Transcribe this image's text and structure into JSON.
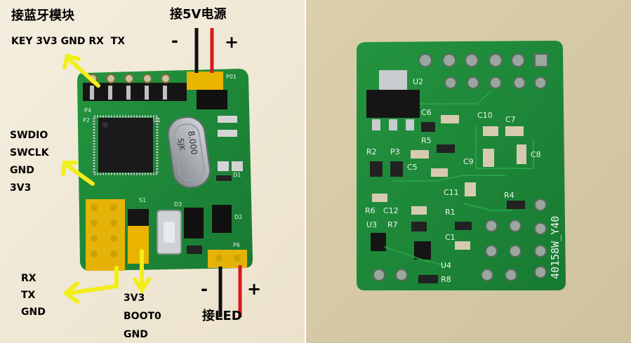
{
  "image_title": "",
  "board_front": {
    "labels": {
      "bluetooth_title": "接蓝牙模块",
      "bluetooth_pins": "KEY 3V3 GND RX  TX",
      "power_title": "接5V电源",
      "power_minus": "-",
      "power_plus": "+",
      "swd_pins": [
        "SWDIO",
        "SWCLK",
        "GND",
        "3V3"
      ],
      "uart_pins": [
        "RX",
        "TX",
        "GND"
      ],
      "boot_pins": [
        "3V3",
        "BOOT0",
        "GND"
      ],
      "led_title": "接LED",
      "led_minus": "-",
      "led_plus": "+"
    },
    "silkscreen": {
      "crystal": "8.000",
      "crystal_mark": "SJK",
      "p4": "P4",
      "p2": "P2",
      "u1": "U1",
      "p1": "P1",
      "d1": "D1",
      "d2": "D2",
      "d3": "D3",
      "s1": "S1",
      "p6": "P6",
      "p01": "P01"
    },
    "colors": {
      "pcb": "#1f8a3a",
      "arrow": "#f2ee1a",
      "jumper": "#e8b400",
      "wire_red": "#d9181c",
      "wire_black": "#111111"
    }
  },
  "board_back": {
    "silkscreen": {
      "model": "40158W_Y40",
      "u2": "U2",
      "u3": "U3",
      "u4": "U4",
      "c1": "C1",
      "c5": "C5",
      "c6": "C6",
      "c7": "C7",
      "c8": "C8",
      "c9": "C9",
      "c10": "C10",
      "c11": "C11",
      "c12": "C12",
      "r1": "R1",
      "r2": "R2",
      "r3": "P3",
      "r4": "R4",
      "r5": "R5",
      "r6": "R6",
      "r7": "R7",
      "r8": "R8"
    }
  }
}
